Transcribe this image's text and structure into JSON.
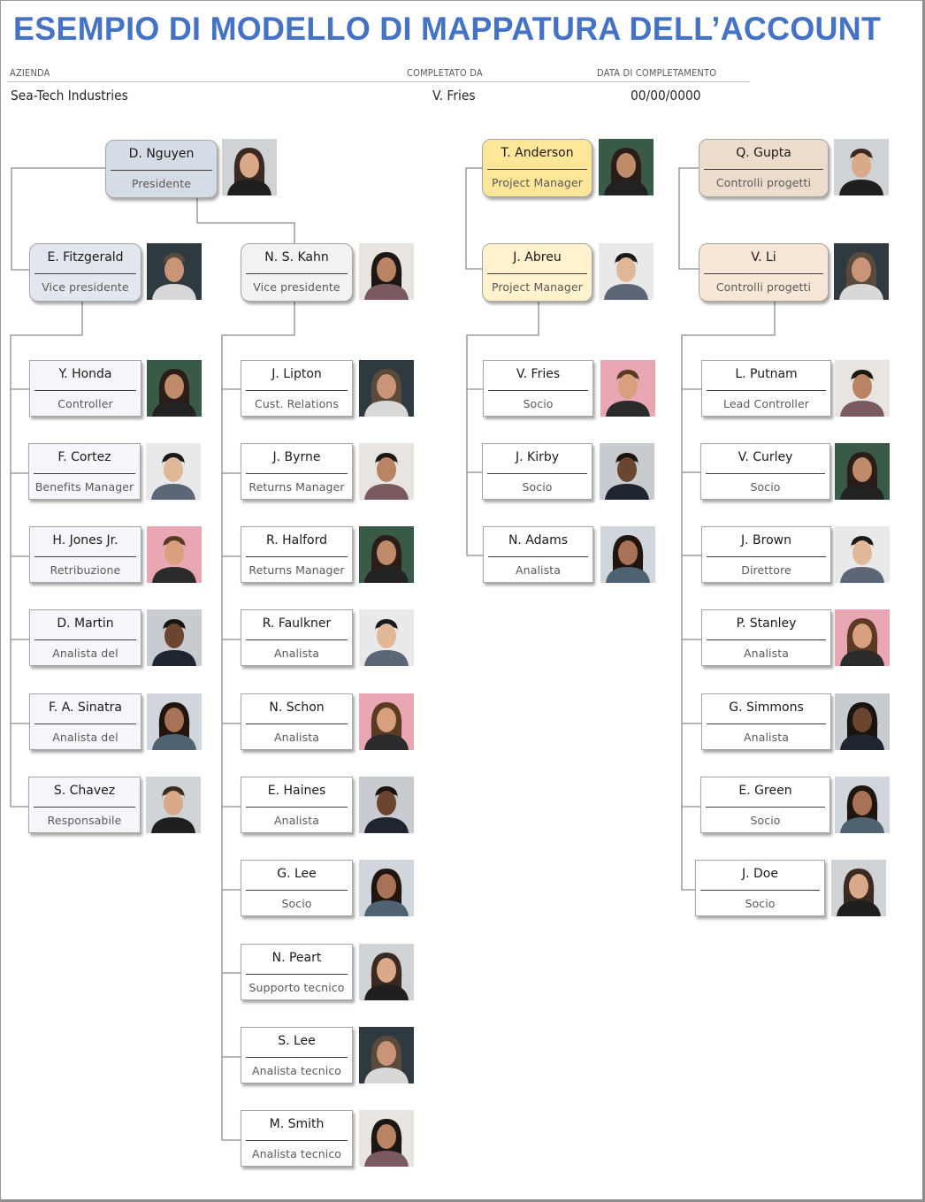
{
  "title": "ESEMPIO DI MODELLO DI MAPPATURA DELL’ACCOUNT",
  "meta": {
    "company_label": "AZIENDA",
    "company_value": "Sea-Tech Industries",
    "completed_by_label": "COMPLETATO DA",
    "completed_by_value": "V. Fries",
    "date_label": "DATA DI COMPLETAMENTO",
    "date_value": "00/00/0000"
  },
  "colors": {
    "title": "#4472c4",
    "president": "#d6dce5",
    "vice_president_left": "#e2e7ee",
    "vice_president_right": "#f2f2f2",
    "project_manager_1": "#ffe699",
    "project_manager_2": "#fff2cc",
    "project_controls_1": "#ecdccb",
    "project_controls_2": "#f8e6d6",
    "staff_left": "#f4f6f9",
    "staff": "#ffffff"
  },
  "nodes": [
    {
      "id": "nguyen",
      "name": "D. Nguyen",
      "role": "Presidente",
      "photo": "woman"
    },
    {
      "id": "fitzgerald",
      "name": "E. Fitzgerald",
      "role": "Vice presidente",
      "photo": "man"
    },
    {
      "id": "kahn",
      "name": "N. S. Kahn",
      "role": "Vice presidente",
      "photo": "woman"
    },
    {
      "id": "honda",
      "name": "Y. Honda",
      "role": "Controller",
      "photo": "woman"
    },
    {
      "id": "cortez",
      "name": "F. Cortez",
      "role": "Benefits Manager",
      "photo": "man"
    },
    {
      "id": "jones",
      "name": "H. Jones Jr.",
      "role": "Retribuzione",
      "photo": "man"
    },
    {
      "id": "martin",
      "name": "D. Martin",
      "role": "Analista del",
      "photo": "man"
    },
    {
      "id": "sinatra",
      "name": "F. A. Sinatra",
      "role": "Analista del",
      "photo": "woman"
    },
    {
      "id": "chavez",
      "name": "S. Chavez",
      "role": "Responsabile",
      "photo": "man"
    },
    {
      "id": "lipton",
      "name": "J. Lipton",
      "role": "Cust. Relations",
      "photo": "woman"
    },
    {
      "id": "byrne",
      "name": "J. Byrne",
      "role": "Returns Manager",
      "photo": "man"
    },
    {
      "id": "halford",
      "name": "R. Halford",
      "role": "Returns Manager",
      "photo": "woman"
    },
    {
      "id": "faulkner",
      "name": "R. Faulkner",
      "role": "Analista",
      "photo": "man"
    },
    {
      "id": "schon",
      "name": "N. Schon",
      "role": "Analista",
      "photo": "woman"
    },
    {
      "id": "haines",
      "name": "E. Haines",
      "role": "Analista",
      "photo": "man"
    },
    {
      "id": "glee",
      "name": "G. Lee",
      "role": "Socio",
      "photo": "woman"
    },
    {
      "id": "peart",
      "name": "N. Peart",
      "role": "Supporto tecnico",
      "photo": "woman"
    },
    {
      "id": "slee",
      "name": "S. Lee",
      "role": "Analista tecnico",
      "photo": "woman"
    },
    {
      "id": "smith",
      "name": "M. Smith",
      "role": "Analista tecnico",
      "photo": "woman"
    },
    {
      "id": "anderson",
      "name": "T. Anderson",
      "role": "Project Manager",
      "photo": "woman"
    },
    {
      "id": "abreu",
      "name": "J. Abreu",
      "role": "Project Manager",
      "photo": "man"
    },
    {
      "id": "fries",
      "name": "V. Fries",
      "role": "Socio",
      "photo": "man"
    },
    {
      "id": "kirby",
      "name": "J. Kirby",
      "role": "Socio",
      "photo": "man"
    },
    {
      "id": "adams",
      "name": "N. Adams",
      "role": "Analista",
      "photo": "woman"
    },
    {
      "id": "gupta",
      "name": "Q. Gupta",
      "role": "Controlli progetti",
      "photo": "man"
    },
    {
      "id": "li",
      "name": "V. Li",
      "role": "Controlli progetti",
      "photo": "woman"
    },
    {
      "id": "putnam",
      "name": "L. Putnam",
      "role": "Lead Controller",
      "photo": "man"
    },
    {
      "id": "curley",
      "name": "V. Curley",
      "role": "Socio",
      "photo": "woman"
    },
    {
      "id": "brown",
      "name": "J. Brown",
      "role": "Direttore",
      "photo": "man"
    },
    {
      "id": "stanley",
      "name": "P. Stanley",
      "role": "Analista",
      "photo": "woman"
    },
    {
      "id": "simmons",
      "name": "G. Simmons",
      "role": "Analista",
      "photo": "woman"
    },
    {
      "id": "green",
      "name": "E. Green",
      "role": "Socio",
      "photo": "woman"
    },
    {
      "id": "doe",
      "name": "J. Doe",
      "role": "Socio",
      "photo": "woman"
    }
  ],
  "reports_to": {
    "fitzgerald": "nguyen",
    "kahn": "nguyen",
    "honda": "fitzgerald",
    "cortez": "fitzgerald",
    "jones": "fitzgerald",
    "martin": "fitzgerald",
    "sinatra": "fitzgerald",
    "chavez": "fitzgerald",
    "lipton": "kahn",
    "byrne": "kahn",
    "halford": "kahn",
    "faulkner": "kahn",
    "schon": "kahn",
    "haines": "kahn",
    "glee": "kahn",
    "peart": "kahn",
    "slee": "kahn",
    "smith": "kahn",
    "abreu": "anderson",
    "fries": "abreu",
    "kirby": "abreu",
    "adams": "abreu",
    "li": "gupta",
    "putnam": "li",
    "curley": "li",
    "brown": "li",
    "stanley": "li",
    "simmons": "li",
    "green": "li",
    "doe": "li"
  }
}
